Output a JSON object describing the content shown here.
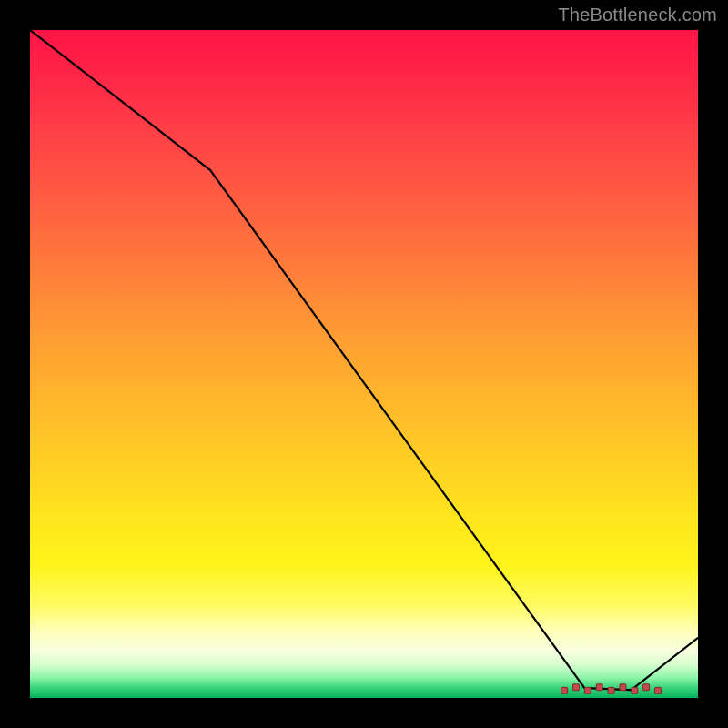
{
  "attribution": "TheBottleneck.com",
  "colors": {
    "line": "#000000",
    "marker_fill": "#c24a4a",
    "marker_stroke": "#7a2e2e"
  },
  "chart_data": {
    "type": "line",
    "title": "",
    "xlabel": "",
    "ylabel": "",
    "xlim": [
      0,
      100
    ],
    "ylim": [
      0,
      100
    ],
    "x": [
      0,
      27,
      83,
      90,
      100
    ],
    "y": [
      100,
      79,
      1.5,
      1.2,
      9
    ],
    "marker_band": {
      "x_start": 80,
      "x_end": 94,
      "y": 1.3,
      "count": 9
    }
  }
}
